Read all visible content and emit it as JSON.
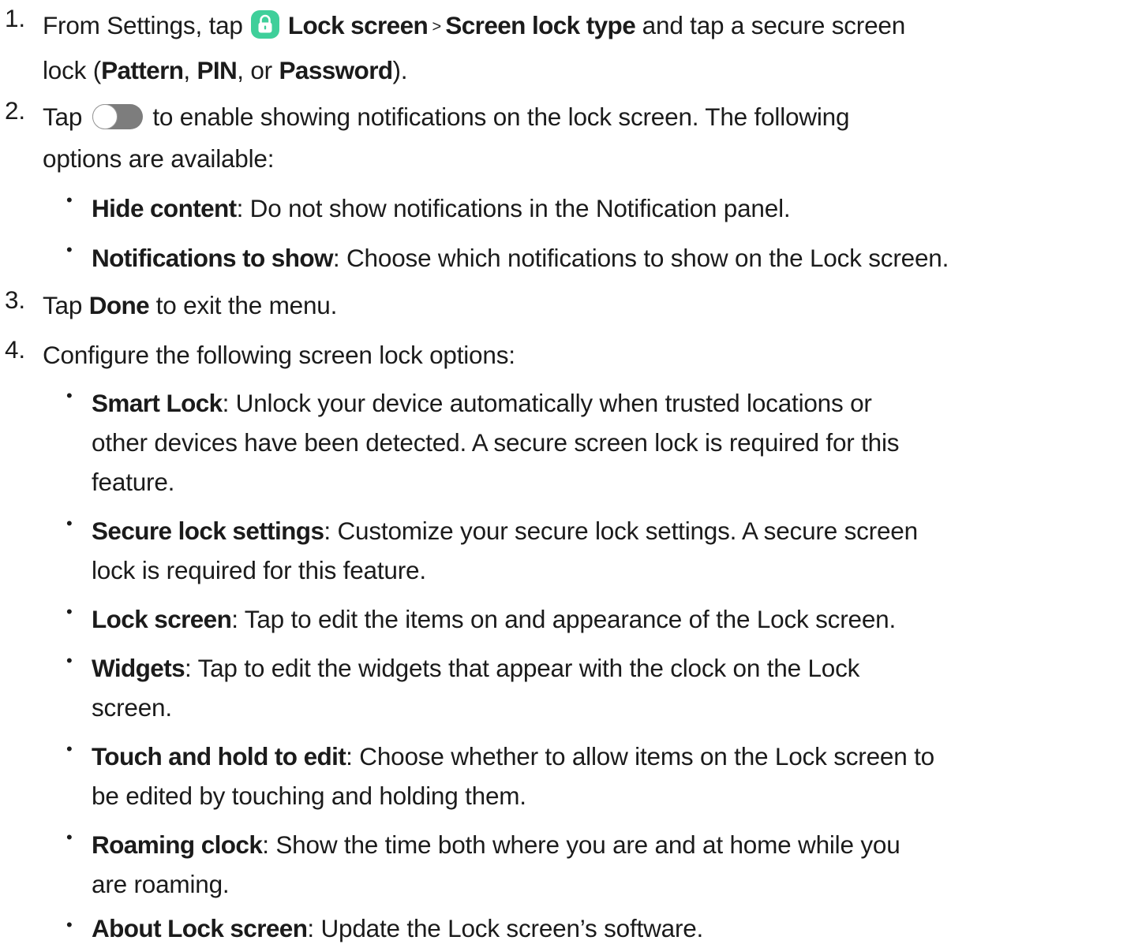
{
  "steps": [
    {
      "number": "1.",
      "t1": "From Settings, tap",
      "t2": "Lock screen",
      "t3": " > ",
      "t4": "Screen lock type",
      "t5": " and tap a secure screen",
      "t6": "lock (",
      "t7": "Pattern",
      "t8": ", ",
      "t9": "PIN",
      "t10": ", or ",
      "t11": "Password",
      "t12": ")."
    },
    {
      "number": "2.",
      "t1": "Tap",
      "t2": "to enable showing notifications on the lock screen. The following",
      "t3": "options are available:",
      "bullets": [
        {
          "term": "Hide content",
          "line1": ": Do not show notifications in the Notification panel."
        },
        {
          "term": "Notifications to show",
          "line1": ": Choose which notifications to show on the Lock screen."
        }
      ]
    },
    {
      "number": "3.",
      "t1": "Tap ",
      "t2": "Done",
      "t3": " to exit the menu."
    },
    {
      "number": "4.",
      "t1": "Configure the following screen lock options:",
      "bullets": [
        {
          "term": "Smart Lock",
          "line1": ": Unlock your device automatically when trusted locations or",
          "line2": "other devices have been detected. A secure screen lock is required for this",
          "line3": "feature."
        },
        {
          "term": "Secure lock settings",
          "line1": ": Customize your secure lock settings. A secure screen",
          "line2": "lock is required for this feature."
        },
        {
          "term": "Lock screen",
          "line1": ": Tap to edit the items on and appearance of the Lock screen."
        },
        {
          "term": "Widgets",
          "line1": ": Tap to edit the widgets that appear with the clock on the Lock",
          "line2": "screen."
        },
        {
          "term": "Touch and hold to edit",
          "line1": ": Choose whether to allow items on the Lock screen to",
          "line2": "be edited by touching and holding them."
        },
        {
          "term": "Roaming clock",
          "line1": ": Show the time both where you are and at home while you",
          "line2": "are roaming."
        },
        {
          "term": "About Lock screen",
          "line1": ": Update the Lock screen’s software."
        }
      ]
    }
  ],
  "bullet_symbol": "•",
  "icons": {
    "lock_icon_name": "lock-icon",
    "lock_icon_color": "#3fcf9a",
    "toggle_icon_name": "toggle-off-icon",
    "toggle_track_color": "#7d7d7d"
  }
}
